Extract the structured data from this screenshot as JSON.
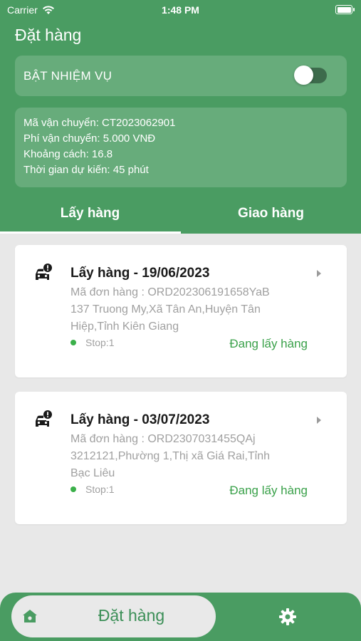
{
  "status_bar": {
    "carrier": "Carrier",
    "time": "1:48 PM"
  },
  "header": {
    "title": "Đặt hàng",
    "mission_label": "BẬT NHIỆM VỤ",
    "mission_toggle_on": false,
    "info": [
      "Mã vận chuyển: CT2023062901",
      "Phí vận chuyển: 5.000 VNĐ",
      "Khoảng cách: 16.8",
      "Thời gian dự kiến: 45 phút"
    ]
  },
  "tabs": [
    {
      "label": "Lấy hàng",
      "active": true
    },
    {
      "label": "Giao hàng",
      "active": false
    }
  ],
  "orders": [
    {
      "title": "Lấy hàng - 19/06/2023",
      "code_line": "Mã đơn hàng : ORD202306191658YaB",
      "address_line1": "137 Truong My,Xã Tân An,Huyện Tân",
      "address_line2": "Hiệp,Tỉnh Kiên Giang",
      "stop": "Stop:1",
      "status": "Đang lấy hàng"
    },
    {
      "title": "Lấy hàng - 03/07/2023",
      "code_line": "Mã đơn hàng : ORD2307031455QAj",
      "address_line1": "3212121,Phường 1,Thị xã Giá Rai,Tỉnh",
      "address_line2": "Bạc Liêu",
      "stop": "Stop:1",
      "status": "Đang lấy hàng"
    }
  ],
  "bottom_nav": {
    "label": "Đặt hàng",
    "left_icon": "home-icon",
    "right_icon": "gear-icon"
  },
  "colors": {
    "primary": "#4a9c62",
    "status_green": "#3aa14a",
    "background": "#e8e8e8"
  }
}
